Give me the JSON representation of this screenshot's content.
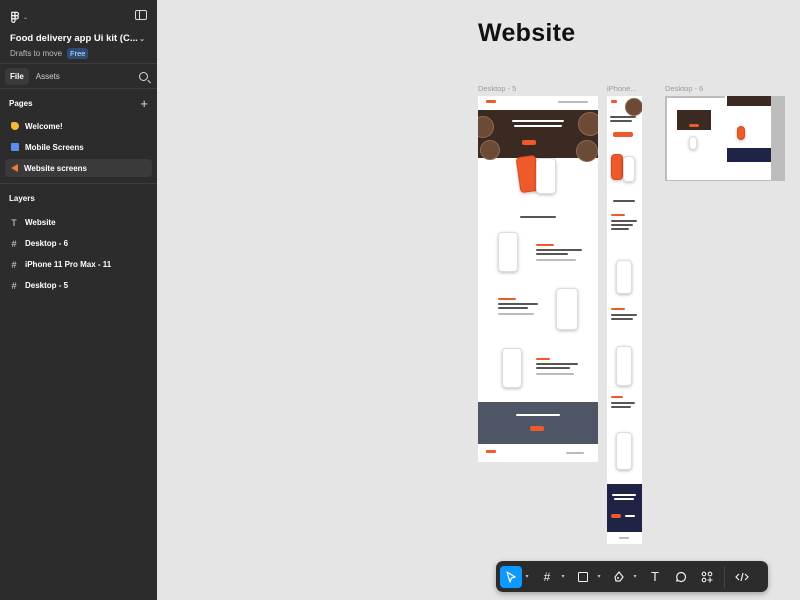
{
  "file": {
    "name": "Food delivery app Ui kit (C...",
    "location": "Drafts to move",
    "plan_badge": "Free"
  },
  "tabs": [
    {
      "label": "File",
      "active": true
    },
    {
      "label": "Assets",
      "active": false
    }
  ],
  "pages": {
    "heading": "Pages",
    "items": [
      {
        "label": "Welcome!",
        "icon": "hand-wave-icon",
        "active": false
      },
      {
        "label": "Mobile Screens",
        "icon": "mobile-screens-icon",
        "active": false
      },
      {
        "label": "Website screens",
        "icon": "triangle-icon",
        "active": true
      }
    ]
  },
  "layers": {
    "heading": "Layers",
    "items": [
      {
        "label": "Website",
        "icon": "text-icon"
      },
      {
        "label": "Desktop - 6",
        "icon": "frame-icon"
      },
      {
        "label": "iPhone 11 Pro Max - 11",
        "icon": "frame-icon"
      },
      {
        "label": "Desktop - 5",
        "icon": "frame-icon"
      }
    ]
  },
  "canvas": {
    "section_title": "Website",
    "frames": [
      {
        "label": "Desktop - 5"
      },
      {
        "label": "iPhone..."
      },
      {
        "label": "Desktop - 6"
      }
    ]
  },
  "mockup": {
    "hero_text": "Why stay hungry when you can order form Bella Onojie",
    "how_title": "How the app works",
    "cta_text": "Download the app now"
  },
  "toolbar": {
    "tools": [
      {
        "name": "move-tool",
        "icon": "cursor-icon",
        "active": true
      },
      {
        "name": "frame-tool",
        "icon": "frame-icon",
        "active": false
      },
      {
        "name": "shape-tool",
        "icon": "rectangle-icon",
        "active": false
      },
      {
        "name": "pen-tool",
        "icon": "pen-icon",
        "active": false
      },
      {
        "name": "text-tool",
        "icon": "text-icon",
        "active": false
      },
      {
        "name": "comment-tool",
        "icon": "comment-icon",
        "active": false
      },
      {
        "name": "actions-tool",
        "icon": "actions-icon",
        "active": false
      },
      {
        "name": "dev-mode-toggle",
        "icon": "code-icon",
        "active": false
      }
    ]
  },
  "colors": {
    "accent": "#0d99ff",
    "sidebar_bg": "#2c2c2c",
    "canvas_bg": "#e5e5e5",
    "brand_orange": "#ef5a2a"
  }
}
